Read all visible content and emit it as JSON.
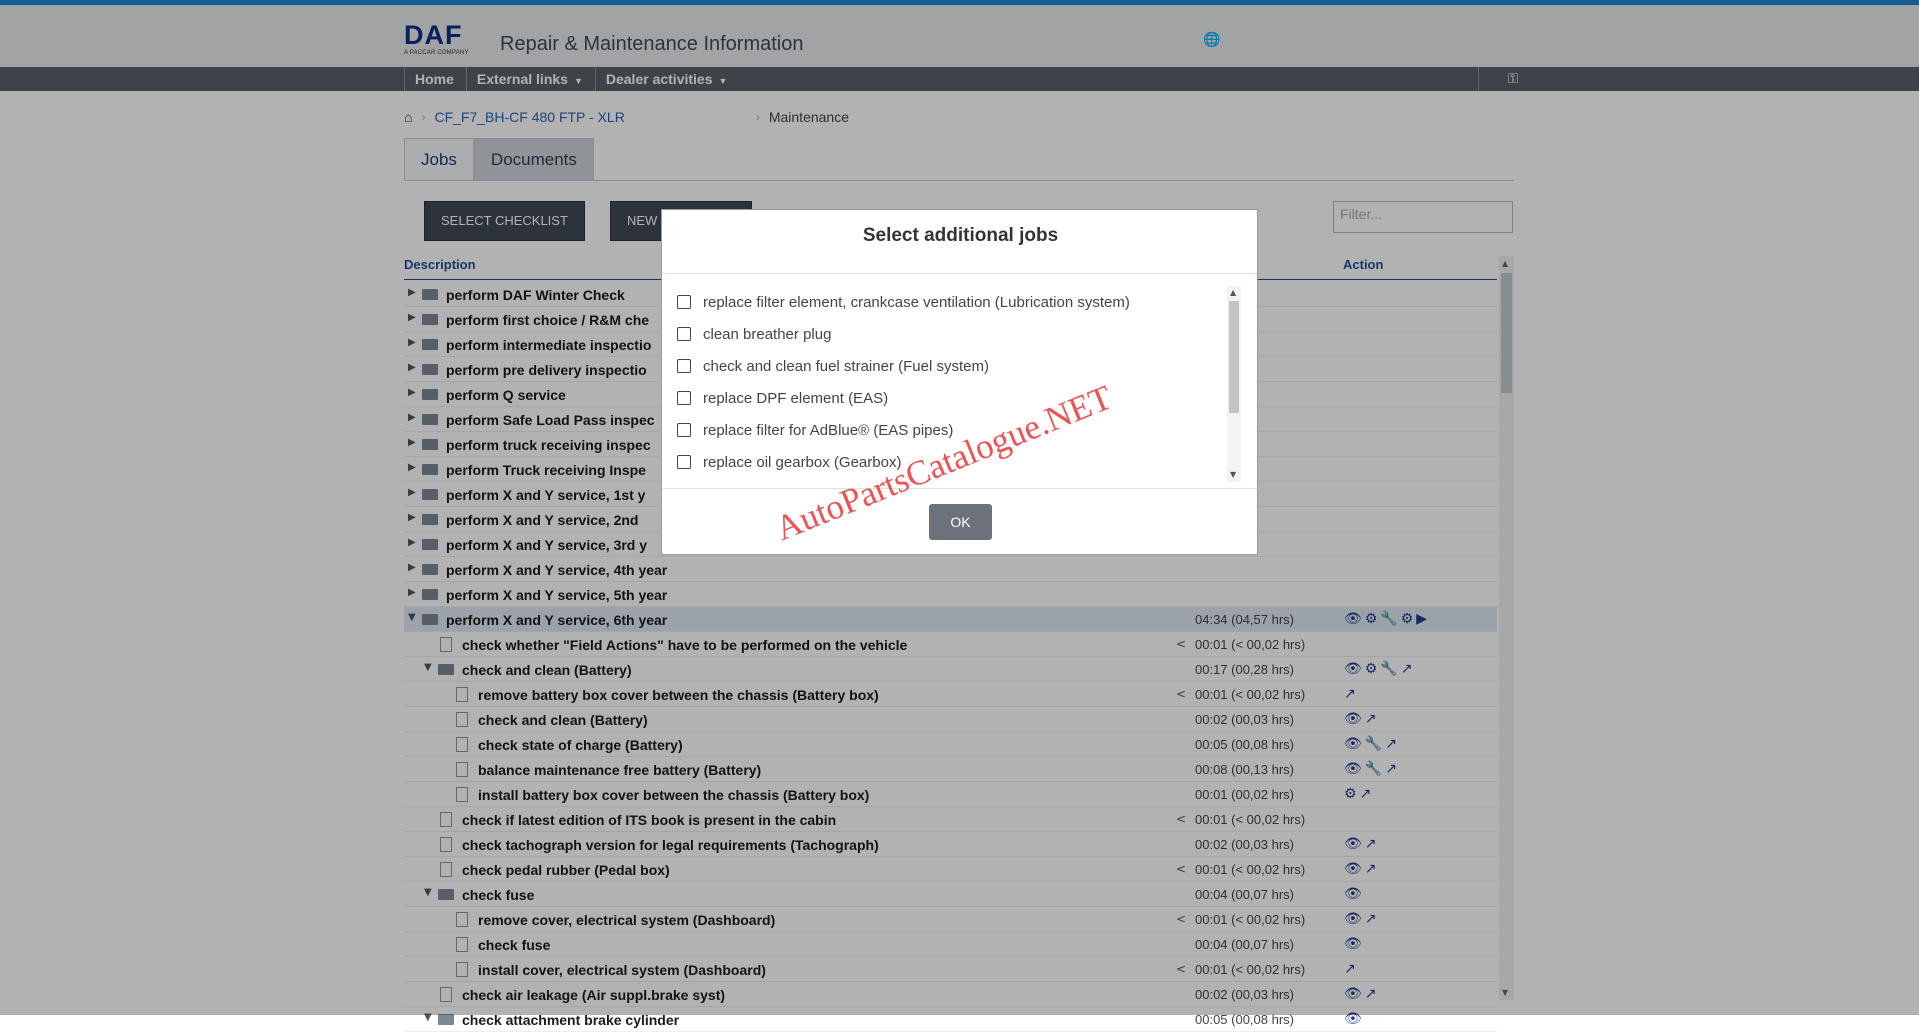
{
  "header": {
    "logo_text": "DAF",
    "logo_sub": "A PACCAR COMPANY",
    "app_title": "Repair & Maintenance Information"
  },
  "nav": {
    "items": [
      {
        "label": "Home",
        "dropdown": false
      },
      {
        "label": "External links",
        "dropdown": true
      },
      {
        "label": "Dealer activities",
        "dropdown": true
      }
    ]
  },
  "breadcrumb": {
    "vehicle": "CF_F7_BH-CF 480 FTP - XLR",
    "current": "Maintenance"
  },
  "tabs": [
    {
      "label": "Jobs",
      "active": true
    },
    {
      "label": "Documents",
      "active": false
    }
  ],
  "toolbar": {
    "select_checklist": "SELECT CHECKLIST",
    "new_label": "NEW",
    "filter_placeholder": "Filter..."
  },
  "columns": {
    "description": "Description",
    "action": "Action"
  },
  "rows": [
    {
      "level": 0,
      "type": "folder",
      "expanded": false,
      "label": "perform DAF Winter Check"
    },
    {
      "level": 0,
      "type": "folder",
      "expanded": false,
      "label": "perform first choice / R&M che"
    },
    {
      "level": 0,
      "type": "folder",
      "expanded": false,
      "label": "perform intermediate inspectio"
    },
    {
      "level": 0,
      "type": "folder",
      "expanded": false,
      "label": "perform pre delivery inspectio"
    },
    {
      "level": 0,
      "type": "folder",
      "expanded": false,
      "label": "perform Q service"
    },
    {
      "level": 0,
      "type": "folder",
      "expanded": false,
      "label": "perform Safe Load Pass inspec"
    },
    {
      "level": 0,
      "type": "folder",
      "expanded": false,
      "label": "perform truck receiving inspec"
    },
    {
      "level": 0,
      "type": "folder",
      "expanded": false,
      "label": "perform Truck receiving Inspe"
    },
    {
      "level": 0,
      "type": "folder",
      "expanded": false,
      "label": "perform X and Y service,  1st y"
    },
    {
      "level": 0,
      "type": "folder",
      "expanded": false,
      "label": "perform X and Y service,  2nd"
    },
    {
      "level": 0,
      "type": "folder",
      "expanded": false,
      "label": "perform X and Y service,  3rd y"
    },
    {
      "level": 0,
      "type": "folder",
      "expanded": false,
      "label": "perform X and Y service,  4th year"
    },
    {
      "level": 0,
      "type": "folder",
      "expanded": false,
      "label": "perform X and Y service,  5th year"
    },
    {
      "level": 0,
      "type": "folder",
      "expanded": true,
      "selected": true,
      "label": "perform X and Y service,  6th year",
      "time": "04:34 (04,57 hrs)",
      "actions": "👁⚙🔧⚙▶"
    },
    {
      "level": 1,
      "type": "doc",
      "label": "check whether \"Field Actions\" have to be performed on the vehicle",
      "lt": "<",
      "time": "00:01 (< 00,02 hrs)"
    },
    {
      "level": 1,
      "type": "folder",
      "expanded": true,
      "label": "check and clean (Battery)",
      "time": "00:17 (00,28 hrs)",
      "actions": "👁⚙🔧↗"
    },
    {
      "level": 2,
      "type": "doc",
      "label": "remove battery box cover between the chassis (Battery box)",
      "lt": "<",
      "time": "00:01 (< 00,02 hrs)",
      "actions": "↗"
    },
    {
      "level": 2,
      "type": "doc",
      "label": "check and clean (Battery)",
      "time": "00:02 (00,03 hrs)",
      "actions": "👁↗"
    },
    {
      "level": 2,
      "type": "doc",
      "label": "check state of charge (Battery)",
      "time": "00:05 (00,08 hrs)",
      "actions": "👁🔧↗"
    },
    {
      "level": 2,
      "type": "doc",
      "label": "balance maintenance free battery (Battery)",
      "time": "00:08 (00,13 hrs)",
      "actions": "👁🔧↗"
    },
    {
      "level": 2,
      "type": "doc",
      "label": "install battery box cover between the chassis (Battery box)",
      "time": "00:01 (00,02 hrs)",
      "actions": "⚙↗"
    },
    {
      "level": 1,
      "type": "doc",
      "label": "check if latest edition of ITS book is present in the cabin",
      "lt": "<",
      "time": "00:01 (< 00,02 hrs)"
    },
    {
      "level": 1,
      "type": "doc",
      "label": "check tachograph version for legal requirements (Tachograph)",
      "time": "00:02 (00,03 hrs)",
      "actions": "👁↗"
    },
    {
      "level": 1,
      "type": "doc",
      "label": "check pedal rubber (Pedal box)",
      "lt": "<",
      "time": "00:01 (< 00,02 hrs)",
      "actions": "👁↗"
    },
    {
      "level": 1,
      "type": "folder",
      "expanded": true,
      "label": "check fuse",
      "time": "00:04 (00,07 hrs)",
      "actions": "👁"
    },
    {
      "level": 2,
      "type": "doc",
      "label": "remove cover, electrical system (Dashboard)",
      "lt": "<",
      "time": "00:01 (< 00,02 hrs)",
      "actions": "👁↗"
    },
    {
      "level": 2,
      "type": "doc",
      "label": "check fuse",
      "time": "00:04 (00,07 hrs)",
      "actions": "👁"
    },
    {
      "level": 2,
      "type": "doc",
      "label": "install cover, electrical system (Dashboard)",
      "lt": "<",
      "time": "00:01 (< 00,02 hrs)",
      "actions": "↗"
    },
    {
      "level": 1,
      "type": "doc",
      "label": "check air leakage (Air suppl.brake syst)",
      "time": "00:02 (00,03 hrs)",
      "actions": "👁↗"
    },
    {
      "level": 1,
      "type": "folder",
      "expanded": true,
      "label": "check attachment brake cylinder",
      "time": "00:05 (00,08 hrs)",
      "actions": "👁"
    }
  ],
  "modal": {
    "title": "Select additional jobs",
    "items": [
      "replace filter element, crankcase ventilation (Lubrication system)",
      "clean breather plug",
      "check and clean fuel strainer (Fuel system)",
      "replace DPF element (EAS)",
      "replace filter for AdBlue® (EAS pipes)",
      "replace oil gearbox (Gearbox)"
    ],
    "ok_label": "OK"
  },
  "watermark": "AutoPartsCatalogue.NET"
}
